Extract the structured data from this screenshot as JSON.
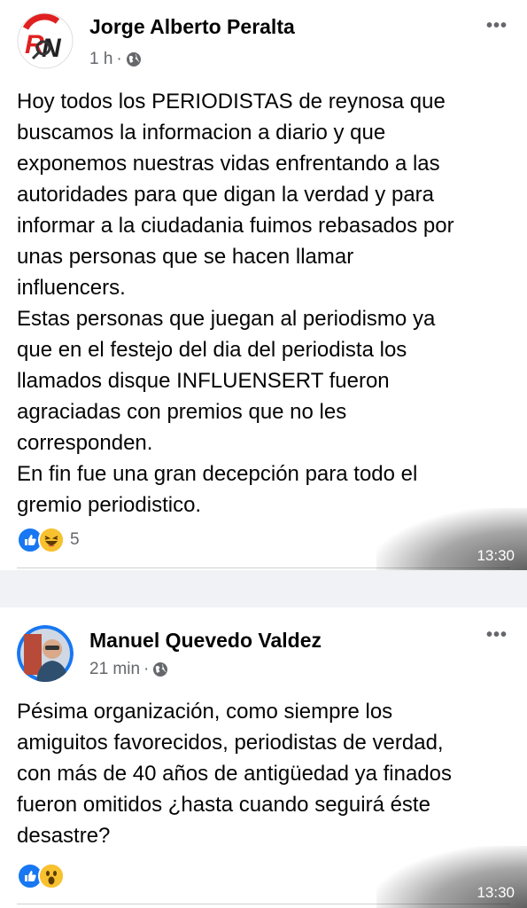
{
  "posts": [
    {
      "author": "Jorge Alberto Peralta",
      "time": "1 h",
      "separator": "·",
      "privacy_icon": "globe-icon",
      "more_label": "•••",
      "text": "Hoy todos los PERIODISTAS de reynosa que\nbuscamos la informacion a diario y que\nexponemos nuestras vidas enfrentando a las\nautoridades para que digan la verdad y para\ninformar a la ciudadania fuimos rebasados por\nunas personas que se hacen llamar\ninfluencers.\nEstas personas que juegan al periodismo ya\nque en el festejo del dia del periodista los\nllamados disque INFLUENSERT fueron\nagraciadas con premios que no les\ncorresponden.\nEn fin fue una gran decepción para todo el\ngremio periodistico.",
      "reactions": [
        "like-icon",
        "haha-icon"
      ],
      "reaction_count": "5",
      "timestamp": "13:30"
    },
    {
      "author": "Manuel Quevedo Valdez",
      "time": "21 min",
      "separator": "·",
      "privacy_icon": "globe-icon",
      "more_label": "•••",
      "text": "Pésima organización, como siempre los\namiguitos favorecidos, periodistas de verdad,\ncon más de 40 años de antigüedad ya finados\nfueron omitidos ¿hasta cuando seguirá éste\ndesastre?",
      "reactions": [
        "like-icon",
        "wow-icon"
      ],
      "timestamp": "13:30"
    }
  ],
  "colors": {
    "like": "#1877f2",
    "haha": "#f7c12f",
    "meta": "#65676b",
    "separator": "#f0f2f5"
  }
}
